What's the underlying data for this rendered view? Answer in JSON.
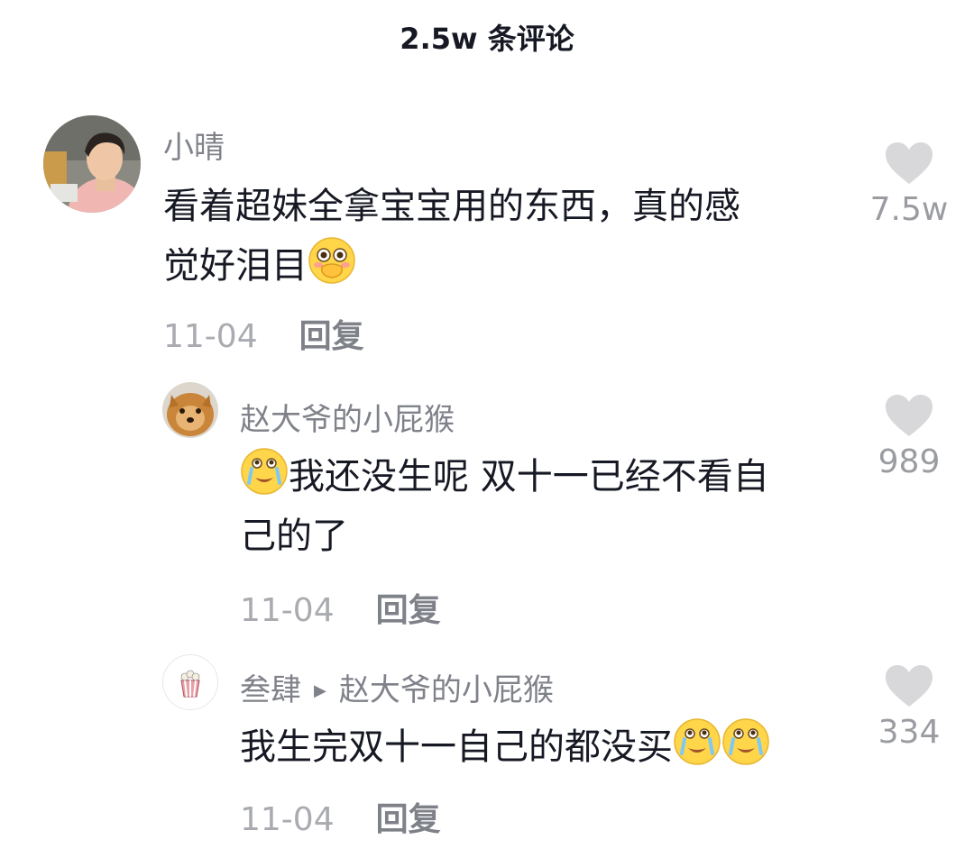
{
  "header": {
    "title": "2.5w 条评论"
  },
  "comments": [
    {
      "username": "小晴",
      "text_line1": "看着超妹全拿宝宝用的东西，真的感",
      "text_line2": "觉好泪目",
      "emoji": "covering-mouth-emoji",
      "date": "11-04",
      "reply_label": "回复",
      "likes": "7.5w"
    },
    {
      "username": "赵大爷的小屁猴",
      "text_line1": "我还没生呢 双十一已经不看自",
      "text_line2": "己的了",
      "emoji": "teary-face-emoji",
      "date": "11-04",
      "reply_label": "回复",
      "likes": "989"
    },
    {
      "username": "叁肆",
      "reply_to": "赵大爷的小屁猴",
      "text": "我生完双十一自己的都没买",
      "emojis": [
        "teary-face-emoji",
        "teary-face-emoji"
      ],
      "date": "11-04",
      "reply_label": "回复",
      "likes": "334"
    }
  ],
  "colors": {
    "text": "#161823",
    "secondary": "#80828a",
    "like_icon": "#d8d8da",
    "emoji_yellow": "#ffd54a"
  }
}
